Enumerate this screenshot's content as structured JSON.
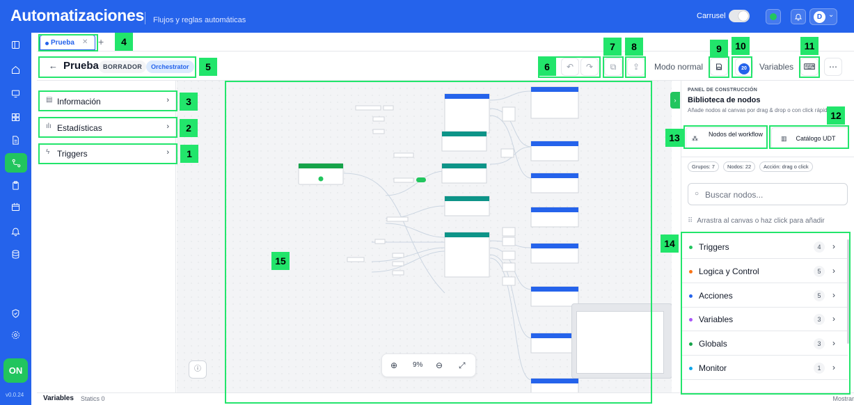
{
  "header": {
    "title": "Automatizaciones",
    "subtitle": "Flujos y reglas automáticas",
    "carrusel_label": "Carrusel",
    "avatar_initial": "D"
  },
  "sidebar": {
    "on_label": "ON",
    "version": "v0.0.24"
  },
  "tabs": [
    {
      "label": "Prueba"
    }
  ],
  "toolbar": {
    "title": "Prueba",
    "status_badge": "BORRADOR",
    "mode_badge": "Orchestrator",
    "mode_label": "Modo normal",
    "variables_label": "Variables",
    "save_count": "20"
  },
  "left_panel": {
    "items": [
      {
        "label": "Información"
      },
      {
        "label": "Estadísticas"
      },
      {
        "label": "Triggers"
      }
    ]
  },
  "canvas": {
    "zoom": "9%"
  },
  "right_panel": {
    "kicker": "PANEL DE CONSTRUCCIÓN",
    "title": "Biblioteca de nodos",
    "description": "Añade nodos al canvas por drag & drop o con click rápido",
    "tab_nodes": "Nodos del workflow",
    "tab_catalog": "Catálogo UDT",
    "chips": [
      "Grupos: 7",
      "Nodos: 22",
      "Acción: drag o click"
    ],
    "search_placeholder": "Buscar nodos...",
    "hint": "Arrastra al canvas o haz click para añadir",
    "categories": [
      {
        "label": "Triggers",
        "count": "4",
        "color": "#22c55e"
      },
      {
        "label": "Logica y Control",
        "count": "5",
        "color": "#f97316"
      },
      {
        "label": "Acciones",
        "count": "5",
        "color": "#2563eb"
      },
      {
        "label": "Variables",
        "count": "3",
        "color": "#a855f7"
      },
      {
        "label": "Globals",
        "count": "3",
        "color": "#16a34a"
      },
      {
        "label": "Monitor",
        "count": "1",
        "color": "#0ea5e9"
      }
    ]
  },
  "statusbar": {
    "variables": "Variables",
    "statics": "Statics 0",
    "show": "Mostrar"
  },
  "markers": [
    "1",
    "2",
    "3",
    "4",
    "5",
    "6",
    "7",
    "8",
    "9",
    "10",
    "11",
    "12",
    "13",
    "14",
    "15"
  ]
}
